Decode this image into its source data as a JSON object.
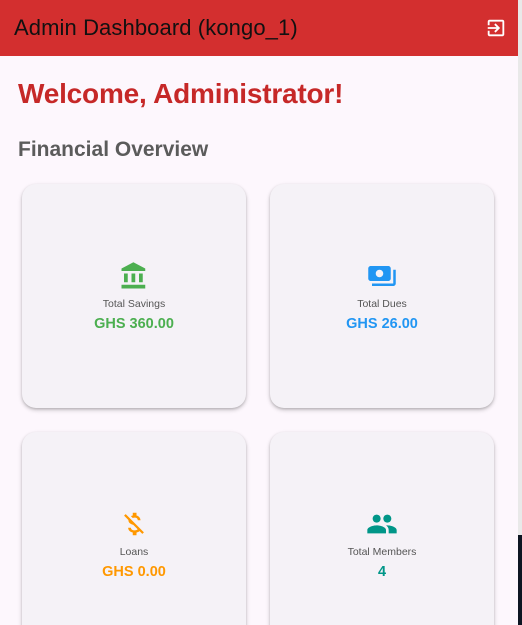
{
  "appbar": {
    "title": "Admin Dashboard (kongo_1)",
    "logout_icon": "logout-icon"
  },
  "welcome": "Welcome, Administrator!",
  "section_title": "Financial Overview",
  "cards": [
    {
      "label": "Total Savings",
      "value": "GHS 360.00",
      "icon": "bank-icon",
      "color": "#4caf50"
    },
    {
      "label": "Total Dues",
      "value": "GHS 26.00",
      "icon": "payments-icon",
      "color": "#2196f3"
    },
    {
      "label": "Loans",
      "value": "GHS 0.00",
      "icon": "money-off-icon",
      "color": "#ff9800"
    },
    {
      "label": "Total Members",
      "value": "4",
      "icon": "people-icon",
      "color": "#009688"
    }
  ],
  "colors": {
    "appbar": "#d32f2f",
    "welcome": "#c62828",
    "background": "#fdf7fd"
  }
}
